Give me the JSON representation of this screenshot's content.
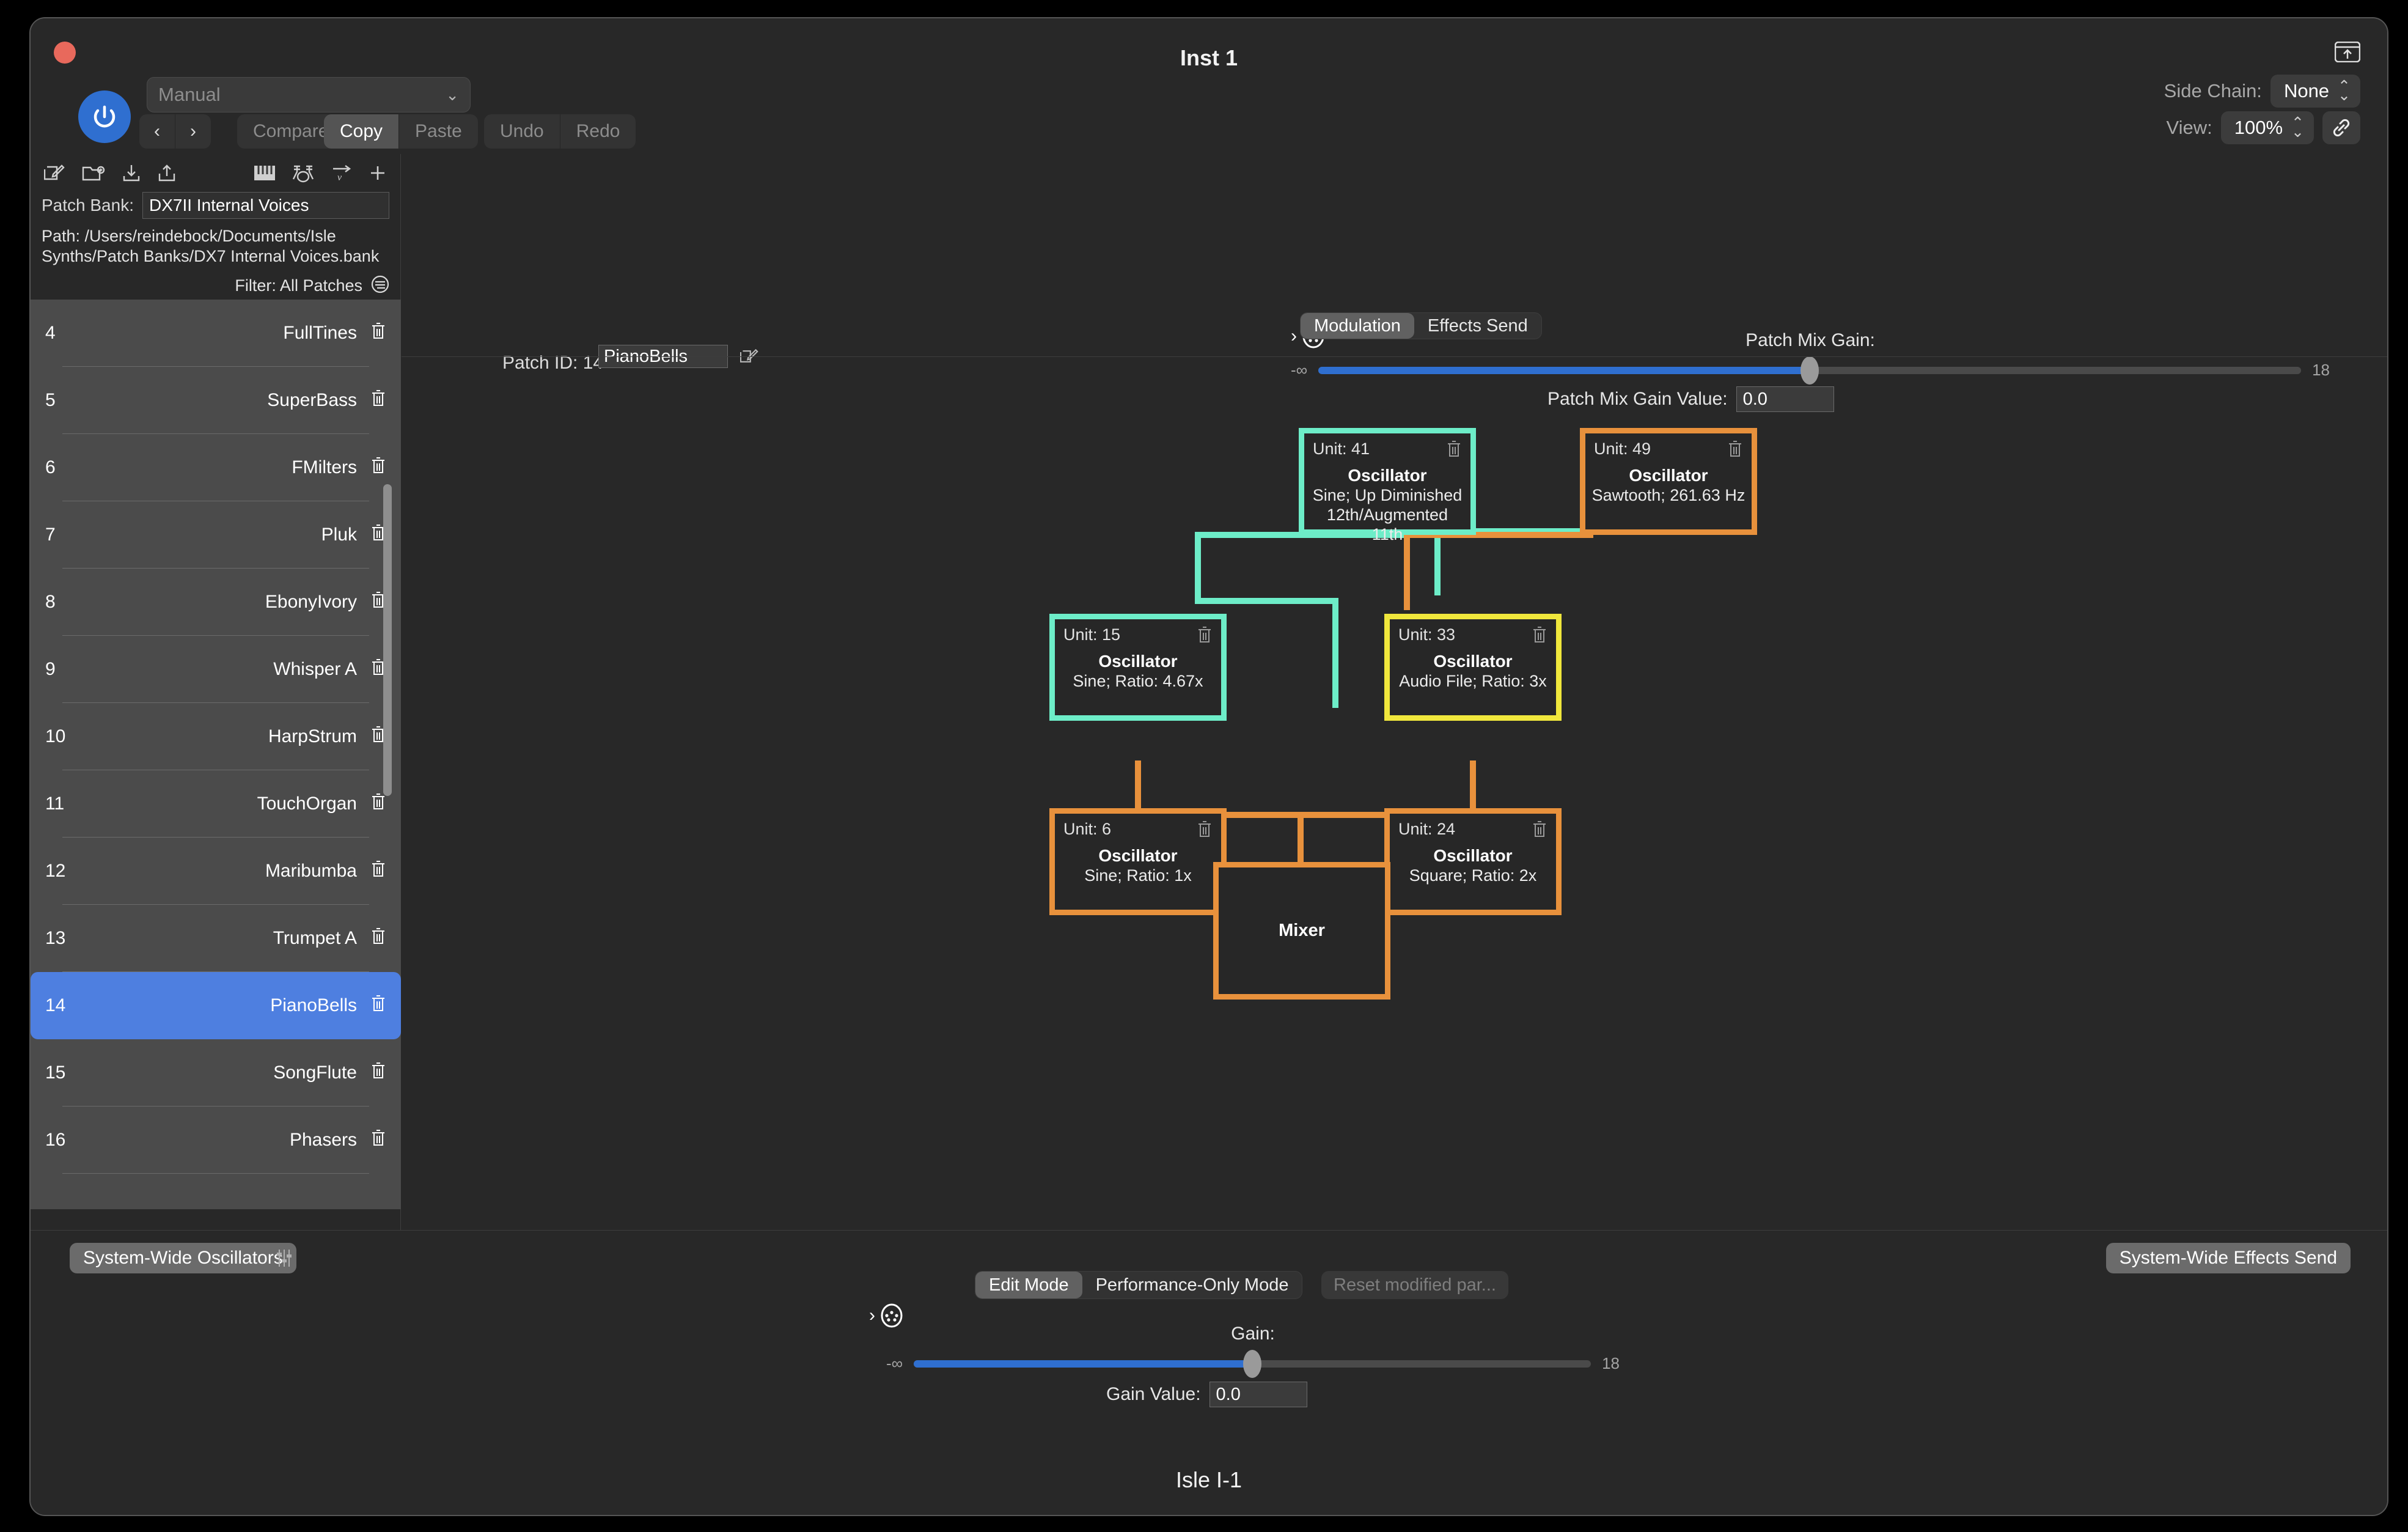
{
  "window": {
    "title": "Inst 1",
    "footer_title": "Isle I-1"
  },
  "header": {
    "preset_value": "Manual",
    "nav_prev": "‹",
    "nav_next": "›",
    "compare": "Compare",
    "copy": "Copy",
    "paste": "Paste",
    "undo": "Undo",
    "redo": "Redo",
    "side_chain_label": "Side Chain:",
    "side_chain_value": "None",
    "view_label": "View:",
    "view_value": "100%"
  },
  "sidebar": {
    "patch_bank_label": "Patch Bank:",
    "patch_bank_value": "DX7II Internal Voices",
    "path": "Path: /Users/reindebock/Documents/Isle Synths/Patch Banks/DX7 Internal Voices.bank",
    "filter": "Filter: All Patches",
    "patches": [
      {
        "num": "4",
        "name": "FullTines",
        "selected": false
      },
      {
        "num": "5",
        "name": "SuperBass",
        "selected": false
      },
      {
        "num": "6",
        "name": "FMilters",
        "selected": false
      },
      {
        "num": "7",
        "name": "Pluk",
        "selected": false
      },
      {
        "num": "8",
        "name": "EbonyIvory",
        "selected": false
      },
      {
        "num": "9",
        "name": "Whisper A",
        "selected": false
      },
      {
        "num": "10",
        "name": "HarpStrum",
        "selected": false
      },
      {
        "num": "11",
        "name": "TouchOrgan",
        "selected": false
      },
      {
        "num": "12",
        "name": "Maribumba",
        "selected": false
      },
      {
        "num": "13",
        "name": "Trumpet A",
        "selected": false
      },
      {
        "num": "14",
        "name": "PianoBells",
        "selected": true
      },
      {
        "num": "15",
        "name": "SongFlute",
        "selected": false
      },
      {
        "num": "16",
        "name": "Phasers",
        "selected": false
      }
    ]
  },
  "main": {
    "patch_id_label": "Patch ID: 14",
    "patch_name": "PianoBells",
    "mix_gain_title": "Patch Mix Gain:",
    "mix_gain_min": "-∞",
    "mix_gain_max": "18",
    "mix_gain_value_label": "Patch Mix Gain Value:",
    "mix_gain_value": "0.0",
    "mix_gain_percent": 50,
    "tab_modulation": "Modulation",
    "tab_effects_send": "Effects Send",
    "active_tab": "Modulation"
  },
  "graph": {
    "nodes": [
      {
        "unit": "Unit: 41",
        "title": "Oscillator",
        "detail": "Sine; Up Diminished 12th/Augmented 11th",
        "color": "#6dedc8"
      },
      {
        "unit": "Unit: 49",
        "title": "Oscillator",
        "detail": "Sawtooth; 261.63 Hz",
        "color": "#e8913c"
      },
      {
        "unit": "Unit: 15",
        "title": "Oscillator",
        "detail": "Sine; Ratio: 4.67x",
        "color": "#6dedc8"
      },
      {
        "unit": "Unit: 33",
        "title": "Oscillator",
        "detail": "Audio File; Ratio: 3x",
        "color": "#f0e73c"
      },
      {
        "unit": "Unit: 6",
        "title": "Oscillator",
        "detail": "Sine; Ratio: 1x",
        "color": "#e8913c"
      },
      {
        "unit": "Unit: 24",
        "title": "Oscillator",
        "detail": "Square; Ratio: 2x",
        "color": "#e8913c"
      }
    ],
    "mixer_label": "Mixer"
  },
  "bottom": {
    "system_wide_oscillators": "System-Wide Oscillators",
    "system_wide_effects_send": "System-Wide Effects Send",
    "edit_mode": "Edit Mode",
    "performance_only_mode": "Performance-Only Mode",
    "reset_modified": "Reset modified par...",
    "gain_title": "Gain:",
    "gain_min": "-∞",
    "gain_max": "18",
    "gain_value_label": "Gain Value:",
    "gain_value": "0.0",
    "gain_percent": 50
  },
  "colors": {
    "accent_blue": "#2f6fd0",
    "selection_blue": "#4e7fe0",
    "teal": "#6dedc8",
    "orange": "#e8913c",
    "yellow": "#f0e73c"
  }
}
